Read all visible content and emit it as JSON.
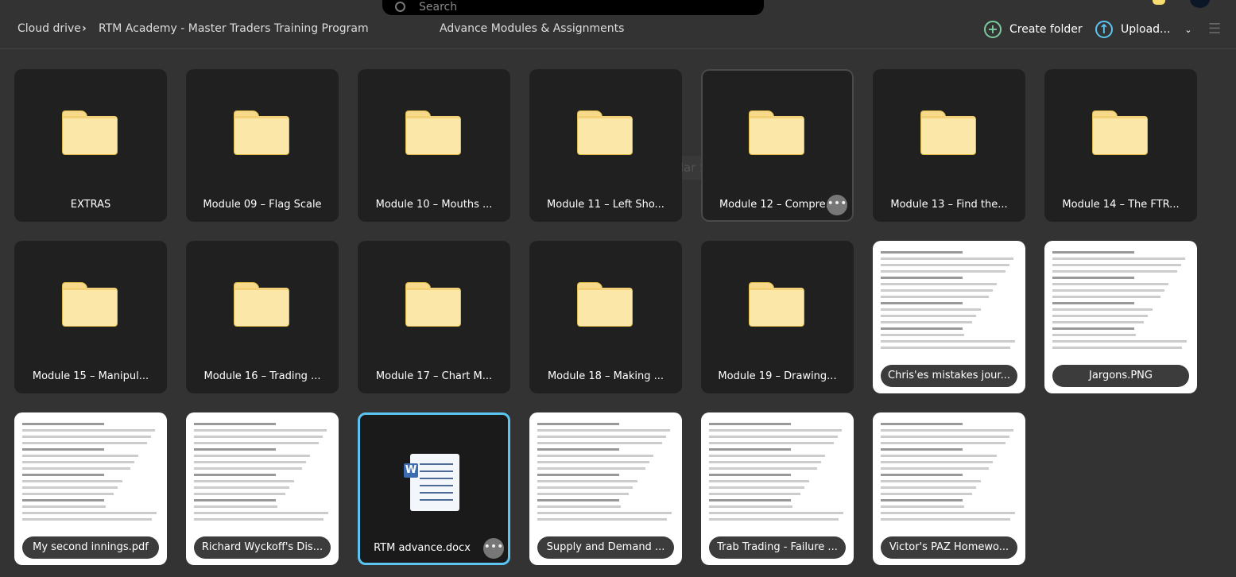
{
  "search": {
    "placeholder": "Search"
  },
  "breadcrumb": {
    "root": "Cloud drive",
    "separator": "›",
    "parent": "RTM Academy - Master Traders Training Program",
    "current": "Advance Modules & Assignments"
  },
  "toolbar": {
    "create_folder": "Create folder",
    "upload": "Upload...",
    "create_color": "#7ccba0",
    "upload_color": "#5bc4f0"
  },
  "overlay": {
    "snip": "Rectangular Snip"
  },
  "items": [
    {
      "name": "EXTRAS",
      "type": "folder"
    },
    {
      "name": "Module 09 – Flag Scale",
      "type": "folder"
    },
    {
      "name": "Module 10 – Mouths ...",
      "type": "folder"
    },
    {
      "name": "Module 11 – Left Sho...",
      "type": "folder"
    },
    {
      "name": "Module 12 – Compre...",
      "type": "folder",
      "state": "hover"
    },
    {
      "name": "Module 13 – Find the...",
      "type": "folder"
    },
    {
      "name": "Module 14 – The FTR...",
      "type": "folder"
    },
    {
      "name": "Module 15 – Manipul...",
      "type": "folder"
    },
    {
      "name": "Module 16 – Trading ...",
      "type": "folder"
    },
    {
      "name": "Module 17 – Chart M...",
      "type": "folder"
    },
    {
      "name": "Module 18 – Making ...",
      "type": "folder"
    },
    {
      "name": "Module 19 – Drawing...",
      "type": "folder"
    },
    {
      "name": "Chris'es mistakes jour...",
      "type": "image"
    },
    {
      "name": "Jargons.PNG",
      "type": "image"
    },
    {
      "name": "My second innings.pdf",
      "type": "image"
    },
    {
      "name": "Richard Wyckoff's Dis...",
      "type": "image"
    },
    {
      "name": "RTM advance.docx",
      "type": "docx",
      "state": "selected"
    },
    {
      "name": "Supply and Demand ...",
      "type": "image"
    },
    {
      "name": "Trab Trading - Failure ...",
      "type": "image"
    },
    {
      "name": "Victor's PAZ Homewo...",
      "type": "image"
    }
  ]
}
